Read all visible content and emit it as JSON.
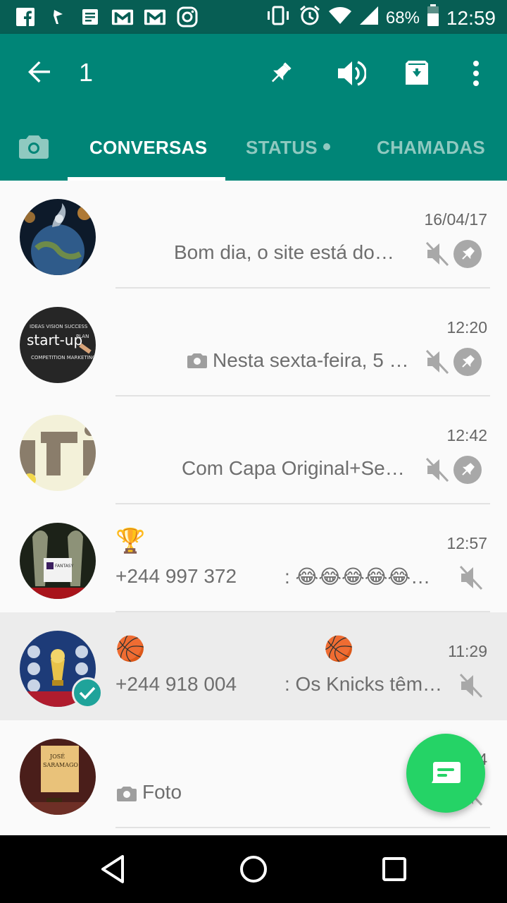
{
  "status_bar": {
    "left_icons": [
      "facebook-icon",
      "flag-icon",
      "news-icon",
      "gmail-icon",
      "gmail-icon",
      "instagram-icon"
    ],
    "battery": "68%",
    "time": "12:59"
  },
  "app_bar": {
    "selected_count": "1",
    "actions": [
      "pin-icon",
      "unmute-icon",
      "archive-icon",
      "more-icon"
    ]
  },
  "tabs": [
    {
      "label": "CONVERSAS",
      "active": true
    },
    {
      "label": "STATUS",
      "active": false,
      "has_dot": true
    },
    {
      "label": "CHAMADAS",
      "active": false
    }
  ],
  "chats": [
    {
      "name": "",
      "time": "16/04/17",
      "preview": "Bom dia, o site está do…",
      "muted": true,
      "pinned": true,
      "selected": false
    },
    {
      "name": "",
      "time": "12:20",
      "preview": "Nesta sexta-feira, 5 …",
      "preview_icon": "camera-icon",
      "muted": true,
      "pinned": true,
      "selected": false
    },
    {
      "name": "",
      "time": "12:42",
      "preview": "Com Capa Original+Se…",
      "muted": true,
      "pinned": true,
      "selected": false
    },
    {
      "name": "🏆",
      "time": "12:57",
      "sender": "+244 997 372",
      "preview": ": 😂😂😂😂😂…",
      "muted": true,
      "pinned": false,
      "selected": false
    },
    {
      "name": "🏀",
      "name_extra": "🏀",
      "time": "11:29",
      "sender": "+244 918 004",
      "preview": ": Os Knicks têm…",
      "muted": true,
      "pinned": false,
      "selected": true
    },
    {
      "name": "",
      "time": "4",
      "preview": "Foto",
      "preview_icon": "camera-icon",
      "muted": true,
      "pinned": false,
      "selected": false
    }
  ],
  "colors": {
    "status_bar": "#075e54",
    "app_bar": "#008577",
    "fab": "#25d366",
    "check_badge": "#1fa39a"
  }
}
